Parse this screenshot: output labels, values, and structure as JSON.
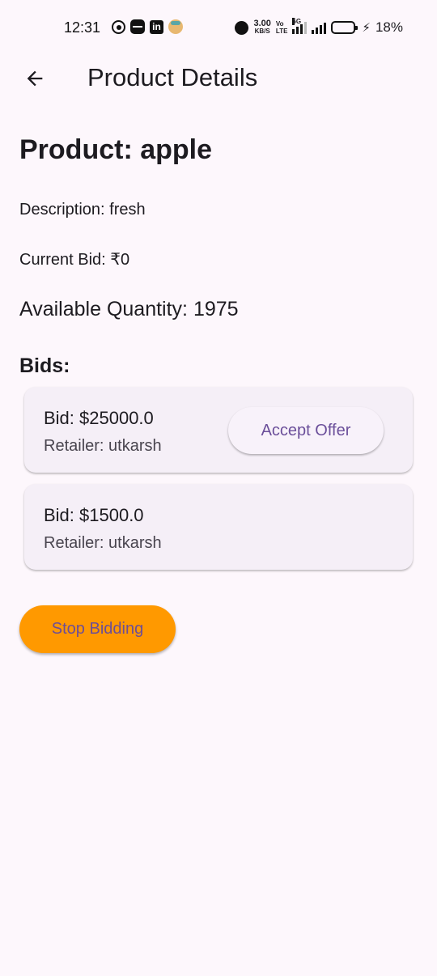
{
  "status_bar": {
    "time": "12:31",
    "speed_value": "3.00",
    "speed_unit": "KB/S",
    "volte_top": "Vo",
    "volte_bottom": "LTE",
    "network_tag": "5G",
    "battery_percent": "18%",
    "left_icons": [
      "whatsapp-icon",
      "zomato-icon",
      "linkedin-icon",
      "app-face-icon"
    ],
    "right_icons": [
      "alarm-icon",
      "signal-icon",
      "signal-icon",
      "battery-icon",
      "charging-icon"
    ]
  },
  "app_bar": {
    "title": "Product Details",
    "back_icon": "arrow-left-icon"
  },
  "product": {
    "title": "Product: apple",
    "description": "Description: fresh",
    "current_bid": "Current Bid: ₹0",
    "available_quantity": "Available Quantity: 1975"
  },
  "bids_section": {
    "heading": "Bids:",
    "items": [
      {
        "bid": "Bid: $25000.0",
        "retailer": "Retailer: utkarsh",
        "action_label": "Accept Offer"
      },
      {
        "bid": "Bid: $1500.0",
        "retailer": "Retailer: utkarsh"
      }
    ]
  },
  "actions": {
    "stop_bidding_label": "Stop Bidding"
  },
  "colors": {
    "background": "#fdf7fc",
    "card": "#f5eff7",
    "accent_text": "#6b4f9a",
    "stop_button": "#ff9900"
  }
}
